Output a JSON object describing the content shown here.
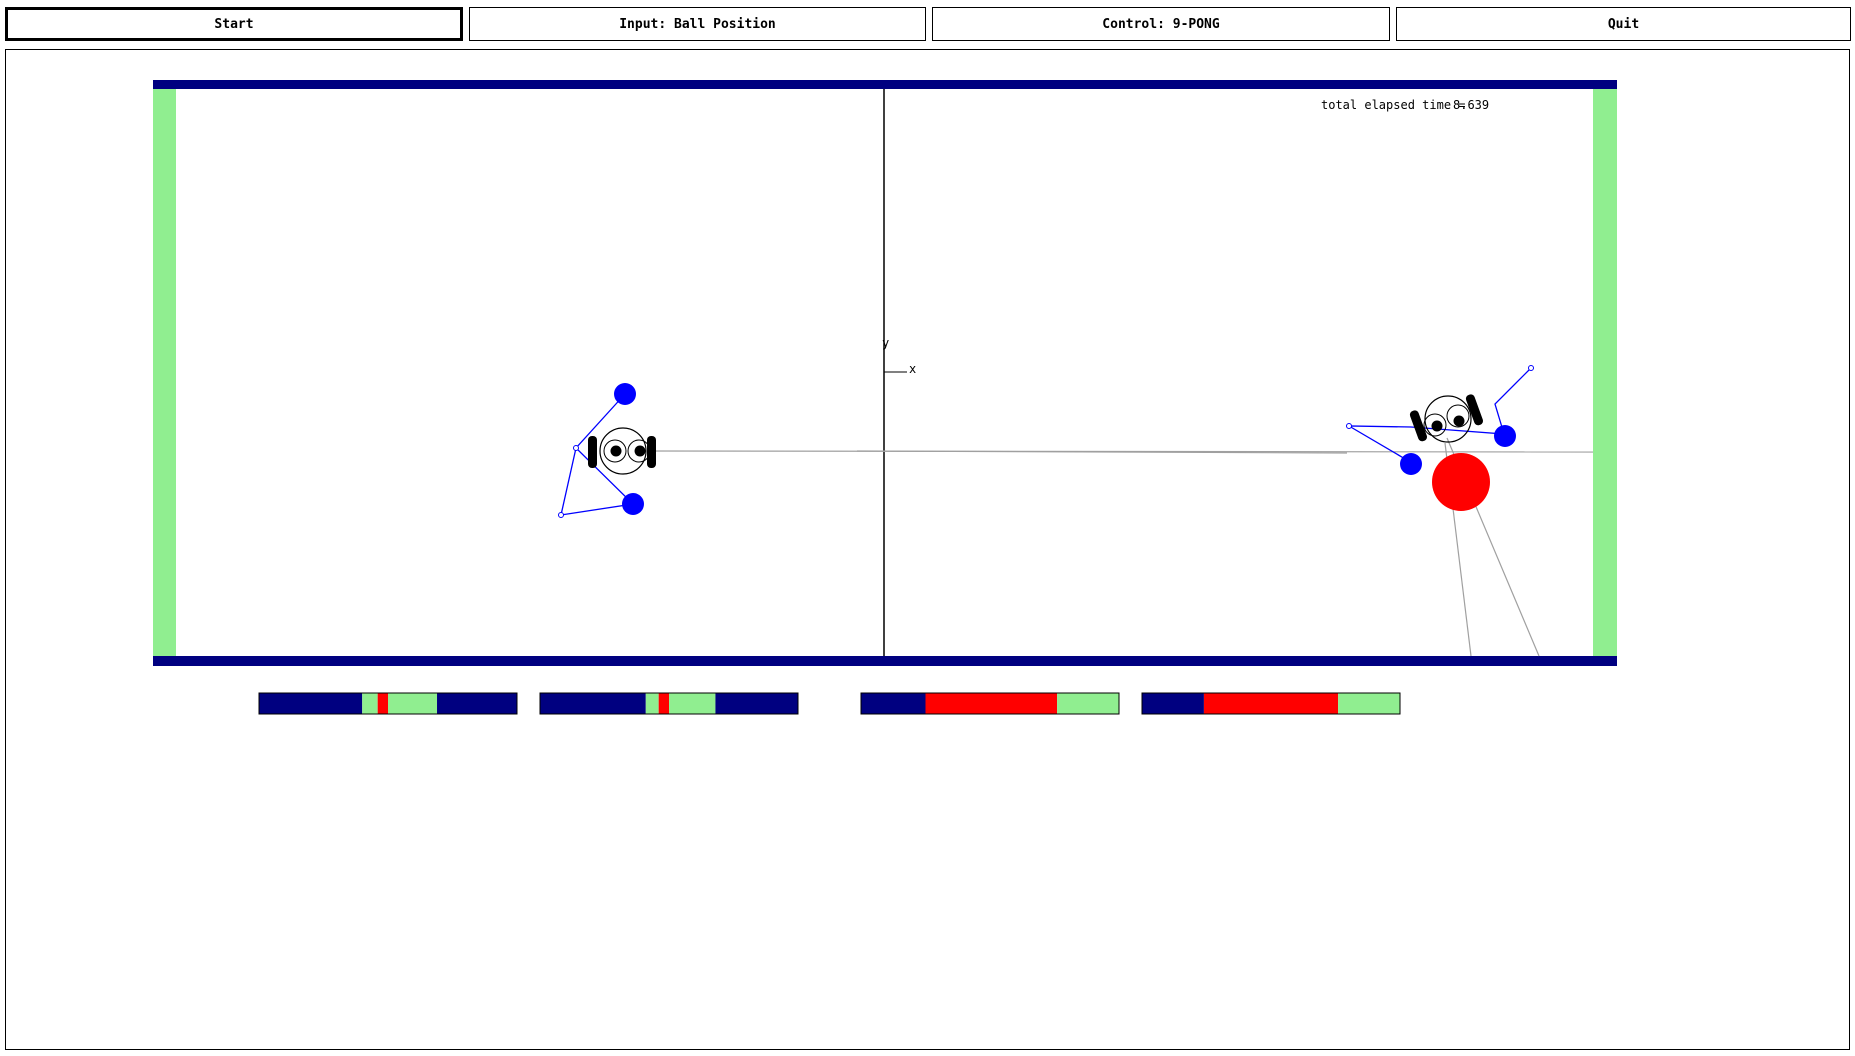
{
  "toolbar": {
    "start_label": "Start",
    "input_label": "Input: Ball Position",
    "control_label": "Control: 9-PONG",
    "quit_label": "Quit"
  },
  "simulation": {
    "elapsed_time_label": "total elapsed time =",
    "elapsed_time_value": "8.639",
    "axis_y_label": "y",
    "axis_x_label": "x"
  },
  "colors": {
    "wall": "#000080",
    "goal": "#90ee90",
    "ball": "#ff0000",
    "marker": "#0000ff"
  },
  "meters": [
    {
      "name": "meter-1",
      "segments": [
        {
          "color": "#000080",
          "fraction": 0.4
        },
        {
          "color": "#90ee90",
          "fraction": 0.06
        },
        {
          "color": "#ff0000",
          "fraction": 0.04
        },
        {
          "color": "#90ee90",
          "fraction": 0.19
        },
        {
          "color": "#000080",
          "fraction": 0.31
        }
      ]
    },
    {
      "name": "meter-2",
      "segments": [
        {
          "color": "#000080",
          "fraction": 0.41
        },
        {
          "color": "#90ee90",
          "fraction": 0.05
        },
        {
          "color": "#ff0000",
          "fraction": 0.04
        },
        {
          "color": "#90ee90",
          "fraction": 0.18
        },
        {
          "color": "#000080",
          "fraction": 0.32
        }
      ]
    },
    {
      "name": "meter-3",
      "segments": [
        {
          "color": "#000080",
          "fraction": 0.25
        },
        {
          "color": "#ff0000",
          "fraction": 0.51
        },
        {
          "color": "#90ee90",
          "fraction": 0.24
        }
      ]
    },
    {
      "name": "meter-4",
      "segments": [
        {
          "color": "#000080",
          "fraction": 0.24
        },
        {
          "color": "#ff0000",
          "fraction": 0.52
        },
        {
          "color": "#90ee90",
          "fraction": 0.24
        }
      ]
    }
  ]
}
